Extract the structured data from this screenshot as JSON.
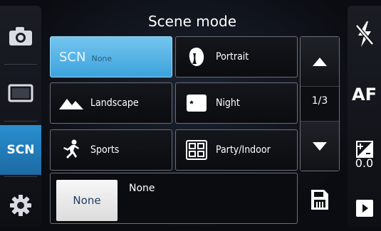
{
  "title": "Scene mode",
  "left_rail": {
    "scn_label": "SCN"
  },
  "scene_tiles": [
    {
      "label": "None",
      "badge": "SCN",
      "selected": true
    },
    {
      "label": "Portrait",
      "icon": "portrait-icon"
    },
    {
      "label": "Landscape",
      "icon": "landscape-icon"
    },
    {
      "label": "Night",
      "icon": "night-icon"
    },
    {
      "label": "Sports",
      "icon": "sports-icon"
    },
    {
      "label": "Party/Indoor",
      "icon": "party-indoor-icon"
    }
  ],
  "pager": {
    "page": "1/3"
  },
  "description": {
    "swatch_label": "None",
    "title": "None"
  },
  "right_rail": {
    "af_label": "AF",
    "ev_value": "0.0"
  },
  "colors": {
    "accent": "#3da3dc",
    "selected_rail": "#2a8fd0"
  }
}
